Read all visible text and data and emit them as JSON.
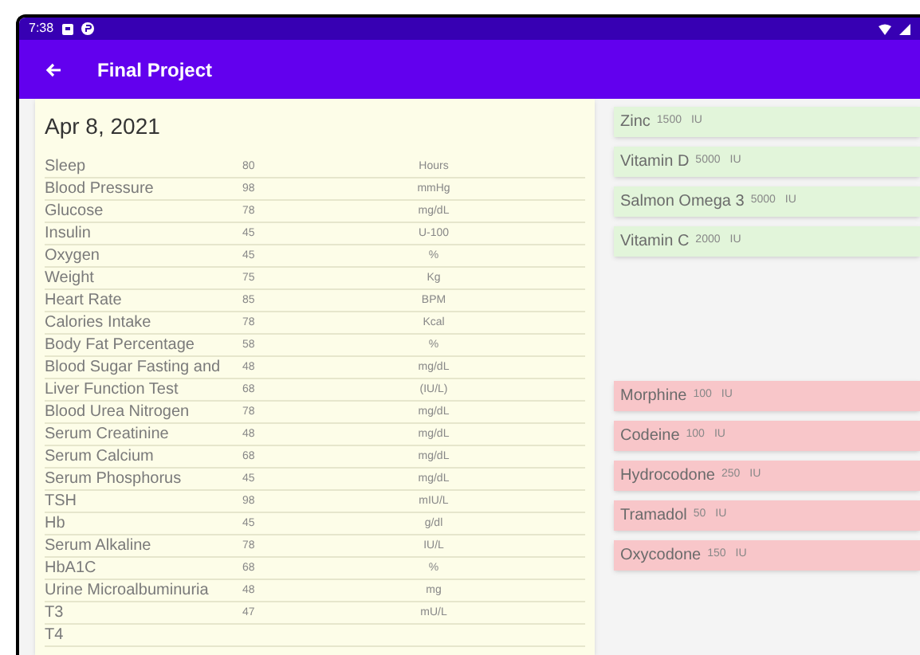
{
  "status_bar": {
    "time": "7:38"
  },
  "app_bar": {
    "title": "Final Project"
  },
  "record": {
    "date": "Apr 8, 2021",
    "rows": [
      {
        "name": "Sleep",
        "value": "80",
        "unit": "Hours"
      },
      {
        "name": "Blood Pressure",
        "value": "98",
        "unit": "mmHg"
      },
      {
        "name": "Glucose",
        "value": "78",
        "unit": "mg/dL"
      },
      {
        "name": "Insulin",
        "value": "45",
        "unit": "U-100"
      },
      {
        "name": "Oxygen",
        "value": "45",
        "unit": "%"
      },
      {
        "name": "Weight",
        "value": "75",
        "unit": "Kg"
      },
      {
        "name": "Heart Rate",
        "value": "85",
        "unit": "BPM"
      },
      {
        "name": "Calories Intake",
        "value": "78",
        "unit": "Kcal"
      },
      {
        "name": "Body Fat Percentage",
        "value": "58",
        "unit": "%"
      },
      {
        "name": "Blood Sugar Fasting and",
        "value": "48",
        "unit": "mg/dL"
      },
      {
        "name": "Liver Function Test",
        "value": "68",
        "unit": "(IU/L)"
      },
      {
        "name": "Blood Urea Nitrogen",
        "value": "78",
        "unit": "mg/dL"
      },
      {
        "name": "Serum Creatinine",
        "value": "48",
        "unit": "mg/dL"
      },
      {
        "name": "Serum Calcium",
        "value": "68",
        "unit": "mg/dL"
      },
      {
        "name": "Serum Phosphorus",
        "value": "45",
        "unit": "mg/dL"
      },
      {
        "name": "TSH",
        "value": "98",
        "unit": "mIU/L"
      },
      {
        "name": "Hb",
        "value": "45",
        "unit": "g/dl"
      },
      {
        "name": "Serum Alkaline",
        "value": "78",
        "unit": "IU/L"
      },
      {
        "name": "HbA1C",
        "value": "68",
        "unit": "%"
      },
      {
        "name": "Urine Microalbuminuria",
        "value": "48",
        "unit": "mg"
      },
      {
        "name": "T3",
        "value": "47",
        "unit": "mU/L"
      },
      {
        "name": "T4"
      }
    ]
  },
  "supplements": [
    {
      "name": "Zinc",
      "amount": "1500",
      "unit": "IU"
    },
    {
      "name": "Vitamin D",
      "amount": "5000",
      "unit": "IU"
    },
    {
      "name": "Salmon Omega 3",
      "amount": "5000",
      "unit": "IU"
    },
    {
      "name": "Vitamin C",
      "amount": "2000",
      "unit": "IU"
    }
  ],
  "medications": [
    {
      "name": "Morphine",
      "amount": "100",
      "unit": "IU"
    },
    {
      "name": "Codeine",
      "amount": "100",
      "unit": "IU"
    },
    {
      "name": "Hydrocodone",
      "amount": "250",
      "unit": "IU"
    },
    {
      "name": "Tramadol",
      "amount": "50",
      "unit": "IU"
    },
    {
      "name": "Oxycodone",
      "amount": "150",
      "unit": "IU"
    }
  ]
}
